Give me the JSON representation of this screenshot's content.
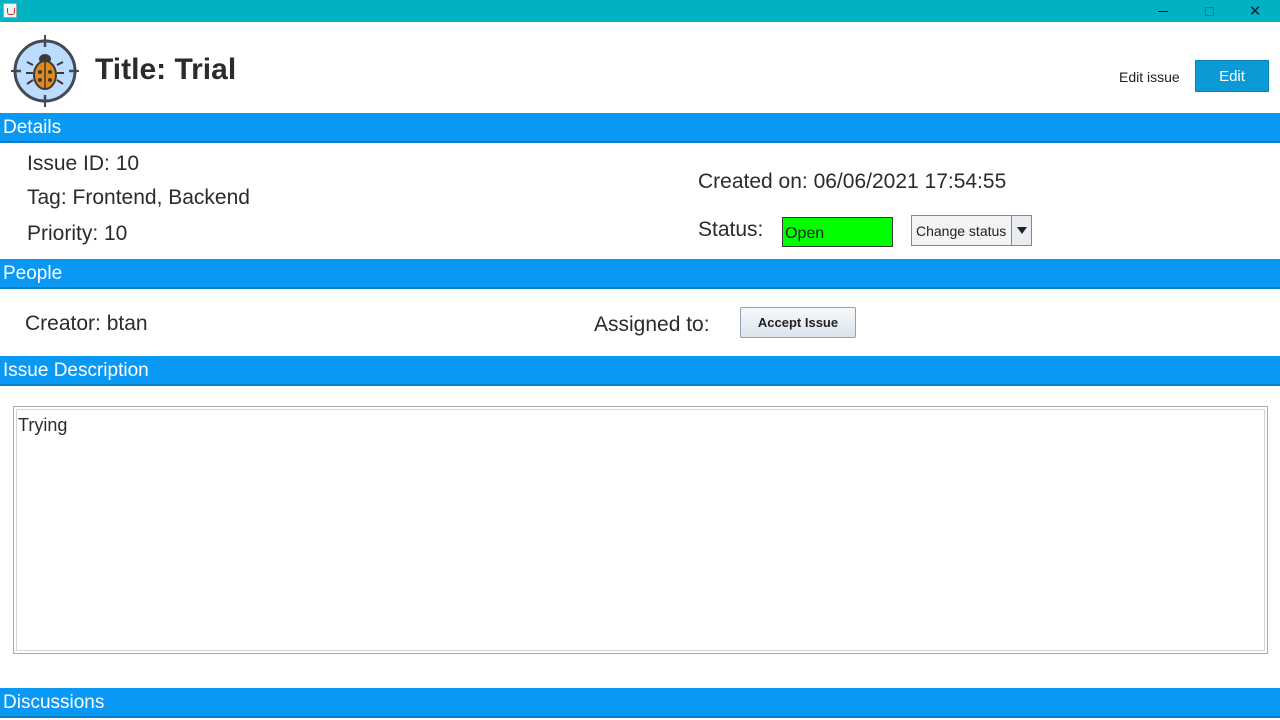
{
  "window": {
    "title": "",
    "controls": {
      "minimize_icon": "minimize-icon",
      "maximize_icon": "maximize-icon",
      "close_icon": "close-icon",
      "close_glyph": "✕"
    },
    "titlebar_color": "#00b2c2"
  },
  "header": {
    "logo_icon": "bug-target-icon",
    "title": "Title: Trial",
    "edit_caption": "Edit issue",
    "edit_button_label": "Edit",
    "edit_button_color": "#0b9ad5"
  },
  "sections": {
    "details": "Details",
    "people": "People",
    "description": "Issue Description",
    "discussions": "Discussions",
    "bar_color": "#0999f5"
  },
  "details": {
    "issue_id": "Issue ID: 10",
    "tag": "Tag: Frontend, Backend",
    "priority": "Priority: 10",
    "created_on": "Created on: 06/06/2021 17:54:55",
    "status_label": "Status:",
    "status_value": "Open",
    "status_color": "#00ff00",
    "change_status_label": "Change status",
    "change_status_arrow_icon": "chevron-down-icon"
  },
  "people": {
    "creator": "Creator: btan",
    "assigned_label": "Assigned to:",
    "accept_button_label": "Accept Issue"
  },
  "description": {
    "text": "Trying"
  }
}
